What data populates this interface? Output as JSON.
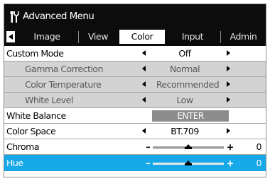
{
  "menu": {
    "title": "Advanced Menu"
  },
  "tabs": [
    {
      "label": "Image"
    },
    {
      "label": "View"
    },
    {
      "label": "Color"
    },
    {
      "label": "Input"
    },
    {
      "label": "Admin"
    }
  ],
  "active_tab": "Color",
  "rows": {
    "custom_mode": {
      "label": "Custom Mode",
      "value": "Off"
    },
    "gamma": {
      "label": "Gamma Correction",
      "value": "Normal"
    },
    "color_temp": {
      "label": "Color Temperature",
      "value": "Recommended"
    },
    "white_level": {
      "label": "White Level",
      "value": "Low"
    },
    "white_balance": {
      "label": "White Balance",
      "button": "ENTER"
    },
    "color_space": {
      "label": "Color Space",
      "value": "BT.709"
    },
    "chroma": {
      "label": "Chroma",
      "value": "0"
    },
    "hue": {
      "label": "Hue",
      "value": "0"
    }
  },
  "colors": {
    "highlight": "#17a8ea",
    "title_bg": "#0c0c0c",
    "sub_bg": "#d3d3d3"
  }
}
